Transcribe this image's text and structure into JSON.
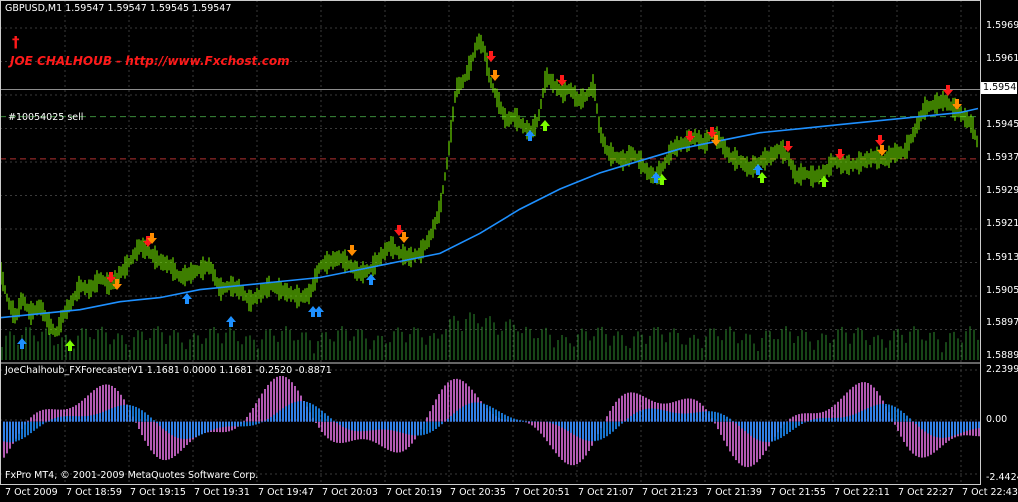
{
  "window": {
    "header": "GBPUSD,M1  1.59547 1.59547 1.59545 1.59547",
    "brand_dagger": "†",
    "brand_text": "JOE CHALHOUB - http://www.Fxchost.com",
    "order_label": "#10054025 sell",
    "indicator_header": "JoeChalhoub_FXForecasterV1 1.1681 0.0000 1.1681 -0.2520 -0.8871",
    "copyright": "FxPro MT4, © 2001-2009 MetaQuotes Software Corp."
  },
  "colors": {
    "background": "#000000",
    "grid": "#3a3a3a",
    "candles": "#7cfc00",
    "moving_average": "#1e90ff",
    "volume": "#2e8b2e",
    "osc_positive": "#e070e0",
    "osc_smooth": "#1e90ff",
    "sell_arrow": "#ff1a1a",
    "sell_arrow_alt": "#ff8c00",
    "buy_arrow": "#7cfc00",
    "buy_arrow_alt": "#1e90ff",
    "order_line": "#3a8a3a",
    "stop_line": "#b03030"
  },
  "price_axis": {
    "ticks": [
      "1.59695",
      "1.59615",
      "1.59455",
      "1.59375",
      "1.59295",
      "1.59215",
      "1.59135",
      "1.59055",
      "1.58975",
      "1.58895"
    ],
    "current_price": "1.59547"
  },
  "indicator_axis": {
    "ticks": [
      "2.2399",
      "0.00",
      "-2.4424"
    ]
  },
  "time_axis": {
    "ticks": [
      "7 Oct 2009",
      "7 Oct 18:59",
      "7 Oct 19:15",
      "7 Oct 19:31",
      "7 Oct 19:47",
      "7 Oct 20:03",
      "7 Oct 20:19",
      "7 Oct 20:35",
      "7 Oct 20:51",
      "7 Oct 21:07",
      "7 Oct 21:23",
      "7 Oct 21:39",
      "7 Oct 21:55",
      "7 Oct 22:11",
      "7 Oct 22:27",
      "7 Oct 22:43"
    ]
  },
  "chart_data": {
    "type": "line",
    "symbol": "GBPUSD",
    "timeframe": "M1",
    "ohlc_last": {
      "open": 1.59547,
      "high": 1.59547,
      "low": 1.59545,
      "close": 1.59547
    },
    "price_close_path": [
      [
        0,
        1.591
      ],
      [
        8,
        1.5902
      ],
      [
        16,
        1.5898
      ],
      [
        22,
        1.5903
      ],
      [
        30,
        1.5899
      ],
      [
        40,
        1.5901
      ],
      [
        48,
        1.5897
      ],
      [
        56,
        1.5894
      ],
      [
        64,
        1.5899
      ],
      [
        72,
        1.5902
      ],
      [
        80,
        1.5906
      ],
      [
        90,
        1.5905
      ],
      [
        100,
        1.5908
      ],
      [
        110,
        1.5906
      ],
      [
        120,
        1.5909
      ],
      [
        130,
        1.5912
      ],
      [
        140,
        1.5916
      ],
      [
        150,
        1.5914
      ],
      [
        160,
        1.5912
      ],
      [
        170,
        1.5911
      ],
      [
        180,
        1.5908
      ],
      [
        190,
        1.5909
      ],
      [
        200,
        1.591
      ],
      [
        210,
        1.5911
      ],
      [
        220,
        1.5905
      ],
      [
        230,
        1.5906
      ],
      [
        240,
        1.5905
      ],
      [
        250,
        1.5902
      ],
      [
        260,
        1.5904
      ],
      [
        270,
        1.5906
      ],
      [
        280,
        1.5905
      ],
      [
        290,
        1.5904
      ],
      [
        300,
        1.5903
      ],
      [
        310,
        1.5904
      ],
      [
        320,
        1.5911
      ],
      [
        330,
        1.5912
      ],
      [
        340,
        1.5913
      ],
      [
        350,
        1.5911
      ],
      [
        360,
        1.5909
      ],
      [
        370,
        1.591
      ],
      [
        380,
        1.5913
      ],
      [
        390,
        1.5916
      ],
      [
        400,
        1.5914
      ],
      [
        410,
        1.5913
      ],
      [
        420,
        1.5914
      ],
      [
        430,
        1.5918
      ],
      [
        440,
        1.5925
      ],
      [
        448,
        1.5938
      ],
      [
        456,
        1.5955
      ],
      [
        464,
        1.5957
      ],
      [
        472,
        1.5962
      ],
      [
        478,
        1.5967
      ],
      [
        484,
        1.5965
      ],
      [
        490,
        1.5957
      ],
      [
        498,
        1.5952
      ],
      [
        506,
        1.5947
      ],
      [
        514,
        1.5948
      ],
      [
        522,
        1.5946
      ],
      [
        530,
        1.5944
      ],
      [
        538,
        1.5947
      ],
      [
        546,
        1.5958
      ],
      [
        554,
        1.5956
      ],
      [
        562,
        1.5954
      ],
      [
        570,
        1.5955
      ],
      [
        578,
        1.5952
      ],
      [
        586,
        1.5953
      ],
      [
        594,
        1.5956
      ],
      [
        600,
        1.5944
      ],
      [
        608,
        1.5939
      ],
      [
        616,
        1.5938
      ],
      [
        624,
        1.5937
      ],
      [
        632,
        1.5939
      ],
      [
        640,
        1.5937
      ],
      [
        648,
        1.5934
      ],
      [
        656,
        1.5933
      ],
      [
        664,
        1.5936
      ],
      [
        672,
        1.594
      ],
      [
        680,
        1.5941
      ],
      [
        688,
        1.5942
      ],
      [
        696,
        1.5943
      ],
      [
        704,
        1.5941
      ],
      [
        712,
        1.5944
      ],
      [
        720,
        1.5942
      ],
      [
        730,
        1.5938
      ],
      [
        740,
        1.5937
      ],
      [
        750,
        1.5935
      ],
      [
        760,
        1.5937
      ],
      [
        770,
        1.5938
      ],
      [
        780,
        1.594
      ],
      [
        788,
        1.5938
      ],
      [
        796,
        1.5933
      ],
      [
        804,
        1.5934
      ],
      [
        814,
        1.5933
      ],
      [
        824,
        1.5934
      ],
      [
        834,
        1.5937
      ],
      [
        844,
        1.5936
      ],
      [
        854,
        1.5936
      ],
      [
        864,
        1.5937
      ],
      [
        874,
        1.5938
      ],
      [
        884,
        1.5937
      ],
      [
        894,
        1.5939
      ],
      [
        904,
        1.5939
      ],
      [
        914,
        1.5944
      ],
      [
        924,
        1.595
      ],
      [
        934,
        1.5951
      ],
      [
        944,
        1.5952
      ],
      [
        954,
        1.595
      ],
      [
        964,
        1.5948
      ],
      [
        972,
        1.5946
      ],
      [
        978,
        1.5941
      ]
    ],
    "moving_average_path": [
      [
        0,
        1.5898
      ],
      [
        40,
        1.5899
      ],
      [
        80,
        1.59
      ],
      [
        120,
        1.5902
      ],
      [
        160,
        1.5903
      ],
      [
        200,
        1.5905
      ],
      [
        240,
        1.5906
      ],
      [
        280,
        1.5907
      ],
      [
        320,
        1.5908
      ],
      [
        360,
        1.591
      ],
      [
        400,
        1.5912
      ],
      [
        440,
        1.5914
      ],
      [
        480,
        1.5919
      ],
      [
        520,
        1.5925
      ],
      [
        560,
        1.593
      ],
      [
        600,
        1.5934
      ],
      [
        640,
        1.5937
      ],
      [
        680,
        1.594
      ],
      [
        720,
        1.5942
      ],
      [
        760,
        1.5944
      ],
      [
        800,
        1.5945
      ],
      [
        840,
        1.5946
      ],
      [
        880,
        1.5947
      ],
      [
        920,
        1.5948
      ],
      [
        960,
        1.5949
      ],
      [
        978,
        1.595
      ]
    ],
    "order_level": 1.5948,
    "stop_level": 1.59375,
    "current_level": 1.59547,
    "oscillator_range": [
      -2.4424,
      2.2399
    ]
  }
}
